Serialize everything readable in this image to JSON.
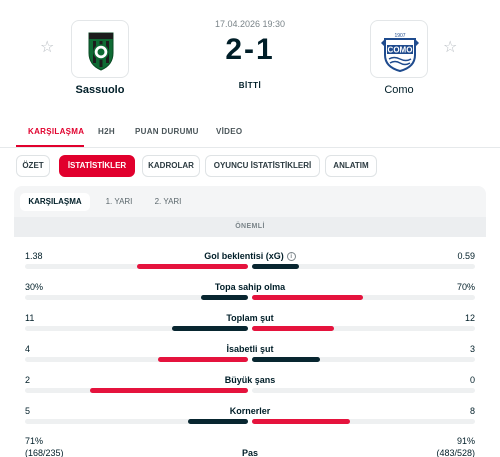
{
  "match": {
    "date": "17.04.2026 19:30",
    "score": "2-1",
    "status": "BİTTİ",
    "home": {
      "name": "Sassuolo",
      "logo": "sassuolo-crest",
      "favorite_icon": "star-outline-icon"
    },
    "away": {
      "name": "Como",
      "logo": "como-crest",
      "logo_text": "COMO",
      "logo_year": "1907",
      "favorite_icon": "star-outline-icon"
    }
  },
  "main_tabs": [
    {
      "label": "KARŞILAŞMA",
      "active": true
    },
    {
      "label": "H2H",
      "active": false
    },
    {
      "label": "PUAN DURUMU",
      "active": false
    },
    {
      "label": "VİDEO",
      "active": false
    }
  ],
  "sub_tabs": [
    {
      "label": "ÖZET",
      "active": false
    },
    {
      "label": "İSTATİSTİKLER",
      "active": true
    },
    {
      "label": "KADROLAR",
      "active": false
    },
    {
      "label": "OYUNCU İSTATİSTİKLERİ",
      "active": false
    },
    {
      "label": "ANLATIM",
      "active": false
    }
  ],
  "period_tabs": [
    {
      "label": "KARŞILAŞMA",
      "active": true
    },
    {
      "label": "1. YARI",
      "active": false
    },
    {
      "label": "2. YARI",
      "active": false
    }
  ],
  "section_title": "ÖNEMLİ",
  "stats": [
    {
      "label": "Gol beklentisi (xG)",
      "home": "1.38",
      "away": "0.59",
      "home_share": 0.7,
      "away_share": 0.3,
      "leader": "home",
      "info": true
    },
    {
      "label": "Topa sahip olma",
      "home": "30%",
      "away": "70%",
      "home_share": 0.3,
      "away_share": 0.7,
      "leader": "away"
    },
    {
      "label": "Toplam şut",
      "home": "11",
      "away": "12",
      "home_share": 0.48,
      "away_share": 0.52,
      "leader": "away"
    },
    {
      "label": "İsabetli şut",
      "home": "4",
      "away": "3",
      "home_share": 0.57,
      "away_share": 0.43,
      "leader": "home"
    },
    {
      "label": "Büyük şans",
      "home": "2",
      "away": "0",
      "home_share": 1.0,
      "away_share": 0.0,
      "leader": "home"
    },
    {
      "label": "Kornerler",
      "home": "5",
      "away": "8",
      "home_share": 0.38,
      "away_share": 0.62,
      "leader": "away"
    }
  ],
  "pass_stat": {
    "label": "Pas",
    "home": "71%",
    "home_sub": "(168/235)",
    "away": "91%",
    "away_sub": "(483/528)"
  },
  "colors": {
    "accent": "#e1002d",
    "leader_bar": "#e5133d",
    "other_bar": "#082630",
    "text": "#001e28"
  }
}
